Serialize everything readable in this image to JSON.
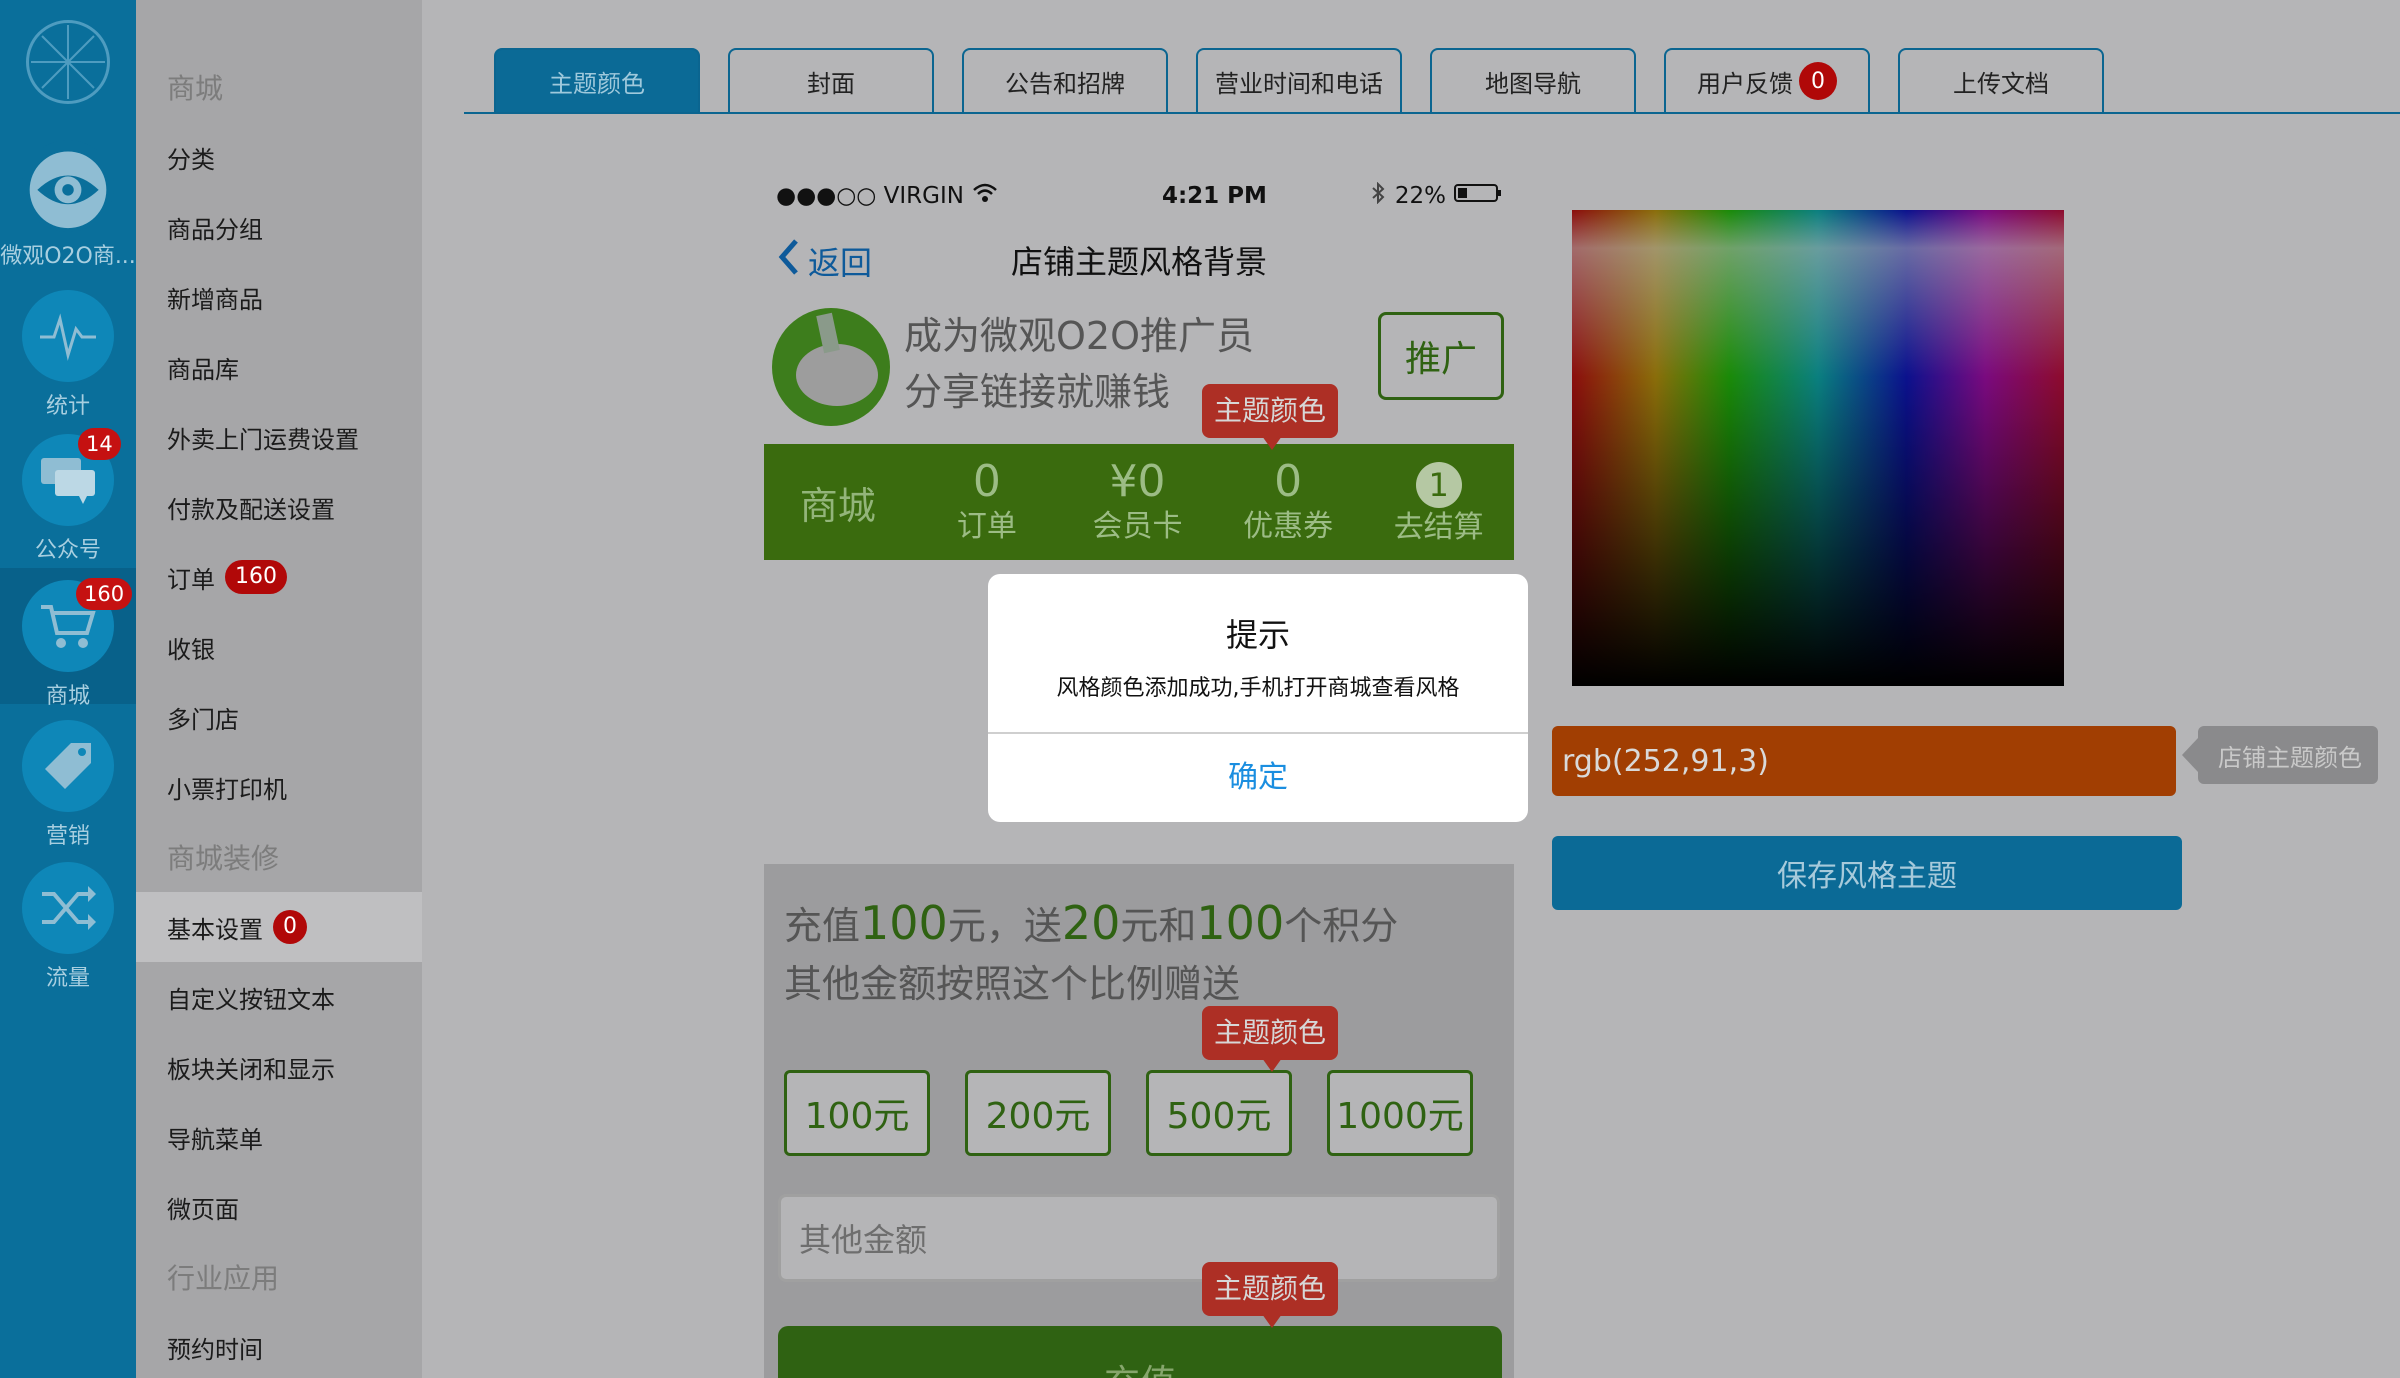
{
  "rail": {
    "items": [
      {
        "label": "微观O2O商...",
        "icon": "eye-icon"
      },
      {
        "label": "统计",
        "icon": "pulse-icon"
      },
      {
        "label": "公众号",
        "icon": "chat-icon",
        "badge": "14"
      },
      {
        "label": "商城",
        "icon": "cart-icon",
        "badge": "160"
      },
      {
        "label": "营销",
        "icon": "tag-icon"
      },
      {
        "label": "流量",
        "icon": "shuffle-icon"
      }
    ]
  },
  "menu": {
    "items": [
      {
        "label": "商城",
        "type": "group"
      },
      {
        "label": "分类"
      },
      {
        "label": "商品分组"
      },
      {
        "label": "新增商品"
      },
      {
        "label": "商品库"
      },
      {
        "label": "外卖上门运费设置"
      },
      {
        "label": "付款及配送设置"
      },
      {
        "label": "订单",
        "badge": "160"
      },
      {
        "label": "收银"
      },
      {
        "label": "多门店"
      },
      {
        "label": "小票打印机"
      },
      {
        "label": "商城装修",
        "type": "group"
      },
      {
        "label": "基本设置",
        "badge": "0"
      },
      {
        "label": "自定义按钮文本"
      },
      {
        "label": "板块关闭和显示"
      },
      {
        "label": "导航菜单"
      },
      {
        "label": "微页面"
      },
      {
        "label": "行业应用",
        "type": "group"
      },
      {
        "label": "预约时间"
      }
    ]
  },
  "tabs": [
    {
      "label": "主题颜色"
    },
    {
      "label": "封面"
    },
    {
      "label": "公告和招牌"
    },
    {
      "label": "营业时间和电话"
    },
    {
      "label": "地图导航"
    },
    {
      "label": "用户反馈",
      "badge": "0"
    },
    {
      "label": "上传文档"
    }
  ],
  "phone": {
    "carrier": "●●●○○ VIRGIN",
    "time": "4:21 PM",
    "battery": "22%",
    "back_label": "返回",
    "nav_title": "店铺主题风格背景",
    "promo_line1": "成为微观O2O推广员",
    "promo_line2": "分享链接就赚钱",
    "promo_button": "推广",
    "bar_title": "商城",
    "stats": [
      {
        "value": "0",
        "label": "订单"
      },
      {
        "value": "¥0",
        "label": "会员卡"
      },
      {
        "value": "0",
        "label": "优惠券"
      },
      {
        "value": "1",
        "label": "去结算"
      }
    ],
    "recharge_text": {
      "part1": "充值",
      "amount": "100",
      "part2": "元，送",
      "gift": "20",
      "part3": "元和",
      "points": "100",
      "part4": "个积分"
    },
    "recharge_line2": "其他金额按照这个比例赠送",
    "amounts": [
      "100元",
      "200元",
      "500元",
      "1000元"
    ],
    "other_placeholder": "其他金额",
    "charge_button": "充值",
    "theme_tag": "主题颜色"
  },
  "picker": {
    "color_value": "rgb(252,91,3)",
    "tooltip": "店铺主题颜色",
    "save_button": "保存风格主题"
  },
  "dialog": {
    "title": "提示",
    "message": "风格颜色添加成功,手机打开商城查看风格",
    "ok_button": "确定"
  },
  "colors": {
    "rail": "#0a6f9b",
    "accent": "#0b6a96",
    "theme_green": "#3a6b0e",
    "theme_selected": "#fc5b03",
    "badge": "#c51111"
  }
}
